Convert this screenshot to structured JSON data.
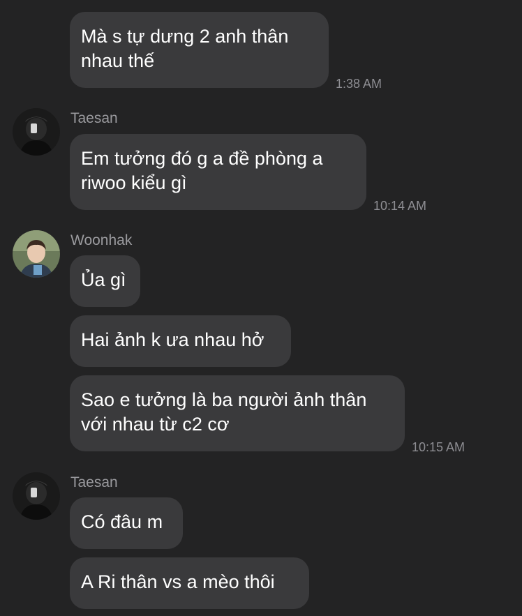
{
  "messages": [
    {
      "text": "Mà s tự dưng 2 anh thân\nnhau thế",
      "time": "1:38 AM"
    },
    {
      "sender": "Taesan",
      "avatar": "taesan-avatar",
      "text": "Em tưởng đó g a đề phòng a\nriwoo kiểu gì",
      "time": "10:14 AM"
    },
    {
      "sender": "Woonhak",
      "avatar": "woonhak-avatar",
      "text": "Ủa gì"
    },
    {
      "text": "Hai ảnh k ưa nhau hở"
    },
    {
      "text": "Sao e tưởng là ba người ảnh thân\nvới nhau từ c2 cơ",
      "time": "10:15 AM"
    },
    {
      "sender": "Taesan",
      "avatar": "taesan-avatar",
      "text": "Có đâu m"
    },
    {
      "text": "A Ri thân vs a mèo thôi"
    }
  ]
}
